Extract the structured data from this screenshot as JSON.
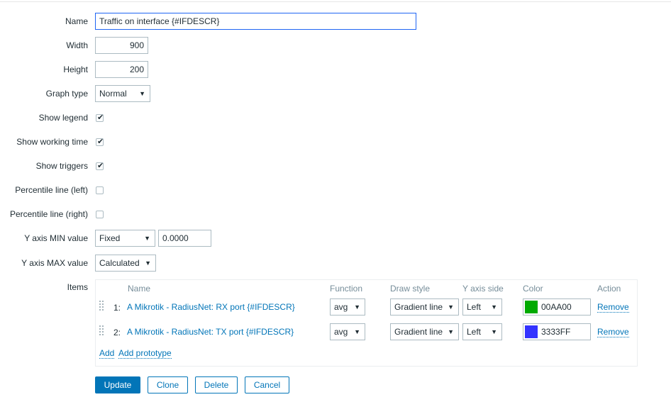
{
  "form": {
    "name_label": "Name",
    "name_value": "Traffic on interface {#IFDESCR}",
    "width_label": "Width",
    "width_value": "900",
    "height_label": "Height",
    "height_value": "200",
    "graph_type_label": "Graph type",
    "graph_type_value": "Normal",
    "show_legend_label": "Show legend",
    "show_legend_checked": true,
    "show_working_time_label": "Show working time",
    "show_working_time_checked": true,
    "show_triggers_label": "Show triggers",
    "show_triggers_checked": true,
    "percentile_left_label": "Percentile line (left)",
    "percentile_left_checked": false,
    "percentile_right_label": "Percentile line (right)",
    "percentile_right_checked": false,
    "ymin_label": "Y axis MIN value",
    "ymin_type": "Fixed",
    "ymin_value": "0.0000",
    "ymax_label": "Y axis MAX value",
    "ymax_type": "Calculated",
    "items_label": "Items"
  },
  "items": {
    "headers": [
      "Name",
      "Function",
      "Draw style",
      "Y axis side",
      "Color",
      "Action"
    ],
    "rows": [
      {
        "num": "1:",
        "name": "A Mikrotik - RadiusNet: RX port {#IFDESCR}",
        "function": "avg",
        "draw_style": "Gradient line",
        "y_axis_side": "Left",
        "color": "00AA00",
        "action": "Remove"
      },
      {
        "num": "2:",
        "name": "A Mikrotik - RadiusNet: TX port {#IFDESCR}",
        "function": "avg",
        "draw_style": "Gradient line",
        "y_axis_side": "Left",
        "color": "3333FF",
        "action": "Remove"
      }
    ],
    "add_label": "Add",
    "add_prototype_label": "Add prototype"
  },
  "buttons": {
    "update": "Update",
    "clone": "Clone",
    "delete": "Delete",
    "cancel": "Cancel"
  },
  "colors": {
    "accent": "#0275b8",
    "row1_color": "#00AA00",
    "row2_color": "#3333FF"
  }
}
